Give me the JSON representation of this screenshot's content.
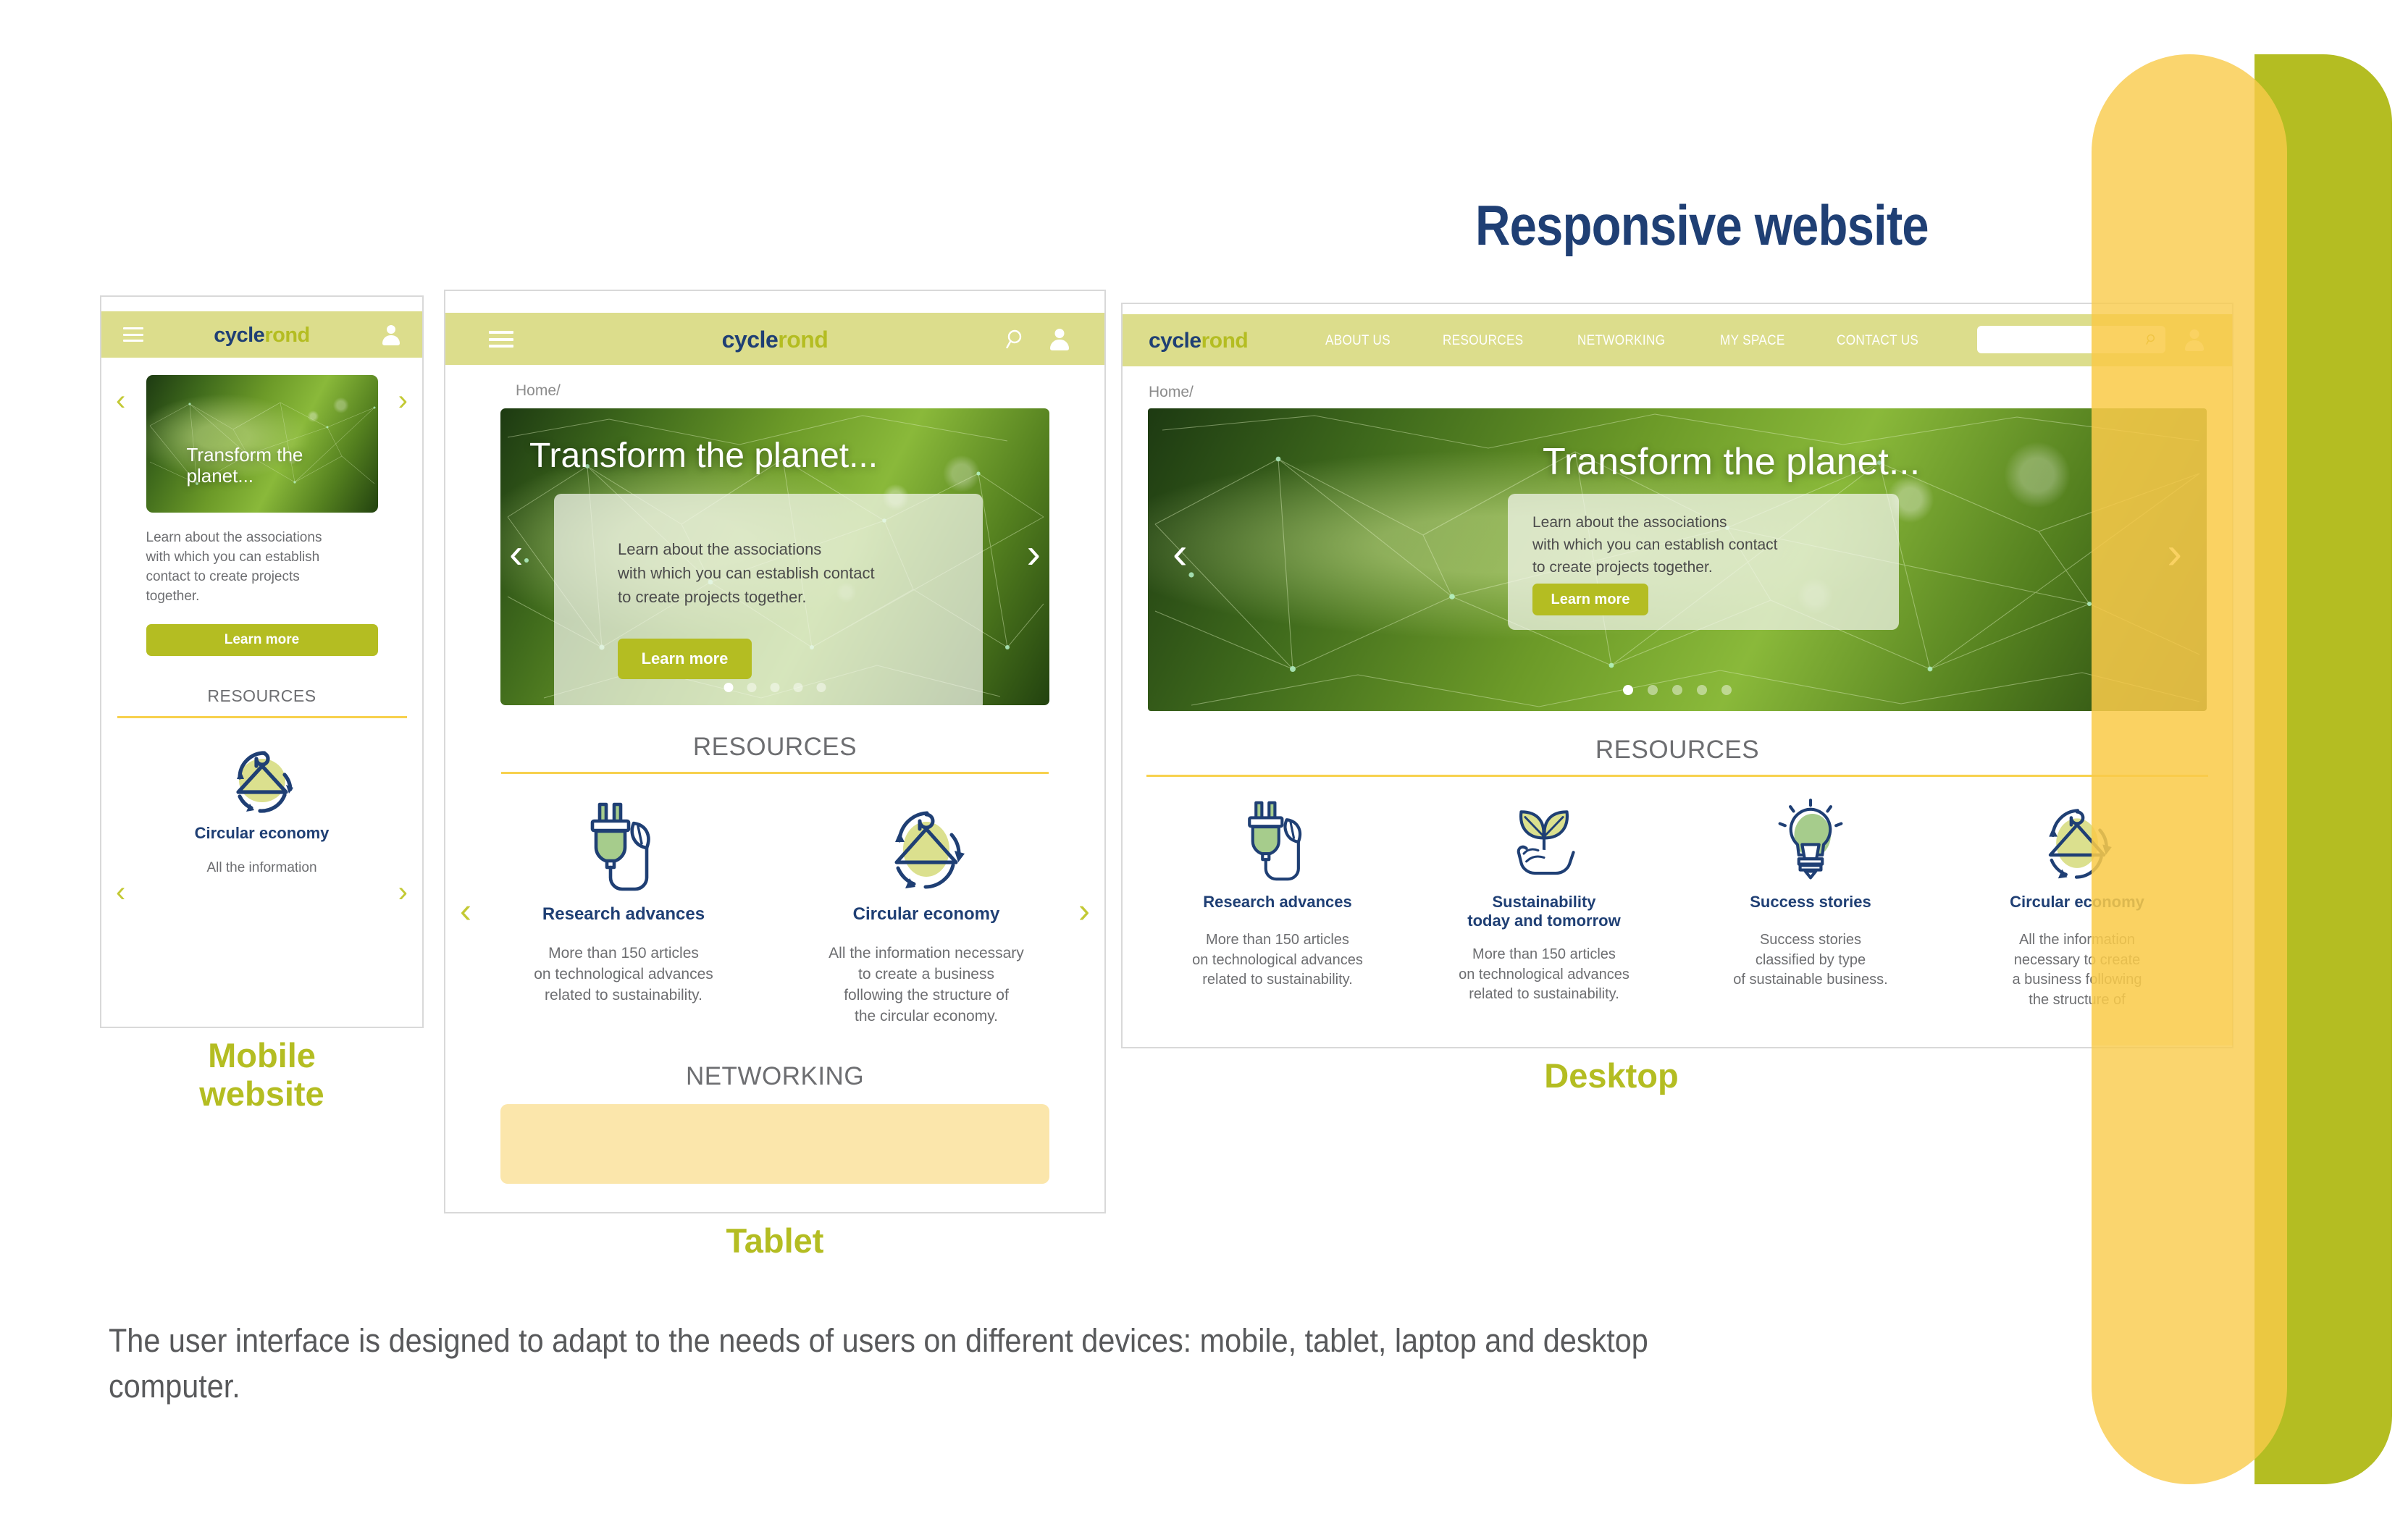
{
  "title": "Responsive website",
  "caption": "The user interface is designed to adapt to the needs of users on different devices: mobile, tablet, laptop and desktop computer.",
  "brand": {
    "part1": "cycle",
    "part2": "rond",
    "navy": "#1f3f74",
    "olive": "#b4bd22",
    "header_bg": "#dcdd8c",
    "rule": "#f7d14e",
    "panel_yellow": "#f9cb4a"
  },
  "breadcrumb": "Home/",
  "hero": {
    "title": "Transform the planet...",
    "body": "Learn about the associations with which you can establish contact to create projects together.",
    "body_mobile_l1": "Learn about the associations",
    "body_mobile_l2": "with which you can establish",
    "body_mobile_l3": "contact to create projects",
    "body_mobile_l4": "together.",
    "body_l1": "Learn about the associations",
    "body_l2": "with which you can establish contact",
    "body_l3": "to create projects together.",
    "cta": "Learn more",
    "dots": 5,
    "active_dot": 1,
    "prev": "‹",
    "next": "›"
  },
  "sections": {
    "resources": "RESOURCES",
    "networking": "NETWORKING"
  },
  "nav": [
    {
      "label": "ABOUT US"
    },
    {
      "label": "RESOURCES"
    },
    {
      "label": "NETWORKING"
    },
    {
      "label": "MY SPACE"
    },
    {
      "label": "CONTACT US"
    }
  ],
  "search": {
    "value": "",
    "placeholder": ""
  },
  "cards": {
    "research": {
      "title": "Research advances",
      "d1": "More than 150 articles",
      "d2": "on technological advances",
      "d3": "related to sustainability.",
      "icon": "plug-leaf-icon"
    },
    "sustainability": {
      "title_l1": "Sustainability",
      "title_l2": "today and tomorrow",
      "d1": "More than 150 articles",
      "d2": "on technological advances",
      "d3": "related to sustainability.",
      "icon": "hand-sprout-icon"
    },
    "success": {
      "title": "Success stories",
      "d1": "Success stories",
      "d2": "classified by type",
      "d3": "of sustainable business.",
      "icon": "lightbulb-icon"
    },
    "circular": {
      "title": "Circular economy",
      "d1": "All the information necessary",
      "d2": "to create a business",
      "d3": "following the structure of",
      "d4": "the circular economy.",
      "dk1": "All the information",
      "dk2": "necessary to create",
      "dk3": "a business following",
      "dk4": "the structure of",
      "mob": "All the information",
      "icon": "hanger-recycle-icon"
    }
  },
  "devices": {
    "mobile_l1": "Mobile",
    "mobile_l2": "website",
    "tablet": "Tablet",
    "desktop": "Desktop"
  }
}
